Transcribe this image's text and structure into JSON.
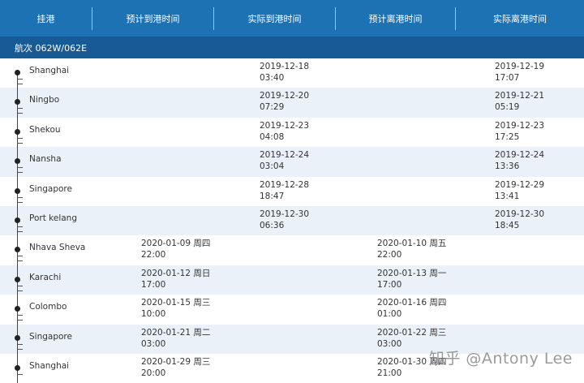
{
  "header": {
    "columns": [
      "挂港",
      "预计到港时间",
      "实际到港时间",
      "预计离港时间",
      "实际离港时间"
    ]
  },
  "voyage": {
    "label": "航次 062W/062E"
  },
  "ports": [
    {
      "name": "Shanghai",
      "est_arr": "",
      "act_arr": "2019-12-18\n03:40",
      "est_dep": "",
      "act_dep": "2019-12-19\n17:07"
    },
    {
      "name": "Ningbo",
      "est_arr": "",
      "act_arr": "2019-12-20\n07:29",
      "est_dep": "",
      "act_dep": "2019-12-21\n05:19"
    },
    {
      "name": "Shekou",
      "est_arr": "",
      "act_arr": "2019-12-23\n04:08",
      "est_dep": "",
      "act_dep": "2019-12-23\n17:25"
    },
    {
      "name": "Nansha",
      "est_arr": "",
      "act_arr": "2019-12-24\n03:04",
      "est_dep": "",
      "act_dep": "2019-12-24\n13:36"
    },
    {
      "name": "Singapore",
      "est_arr": "",
      "act_arr": "2019-12-28\n18:47",
      "est_dep": "",
      "act_dep": "2019-12-29\n13:41"
    },
    {
      "name": "Port kelang",
      "est_arr": "",
      "act_arr": "2019-12-30\n06:36",
      "est_dep": "",
      "act_dep": "2019-12-30\n18:45"
    },
    {
      "name": "Nhava Sheva",
      "est_arr": "2020-01-09 周四\n22:00",
      "act_arr": "",
      "est_dep": "2020-01-10 周五\n22:00",
      "act_dep": ""
    },
    {
      "name": "Karachi",
      "est_arr": "2020-01-12 周日\n17:00",
      "act_arr": "",
      "est_dep": "2020-01-13 周一\n17:00",
      "act_dep": ""
    },
    {
      "name": "Colombo",
      "est_arr": "2020-01-15 周三\n10:00",
      "act_arr": "",
      "est_dep": "2020-01-16 周四\n01:00",
      "act_dep": ""
    },
    {
      "name": "Singapore",
      "est_arr": "2020-01-21 周二\n03:00",
      "act_arr": "",
      "est_dep": "2020-01-22 周三\n03:00",
      "act_dep": ""
    },
    {
      "name": "Shanghai",
      "est_arr": "2020-01-29 周三\n20:00",
      "act_arr": "",
      "est_dep": "2020-01-30 周四\n21:00",
      "act_dep": ""
    }
  ],
  "watermark": "知乎 @Antony Lee",
  "colors": {
    "header": "#1d72b3",
    "voyage_bar": "#185a93",
    "stripe": "#eaf1f8"
  },
  "icons": {
    "timeline_node": "timeline-dot-icon"
  }
}
